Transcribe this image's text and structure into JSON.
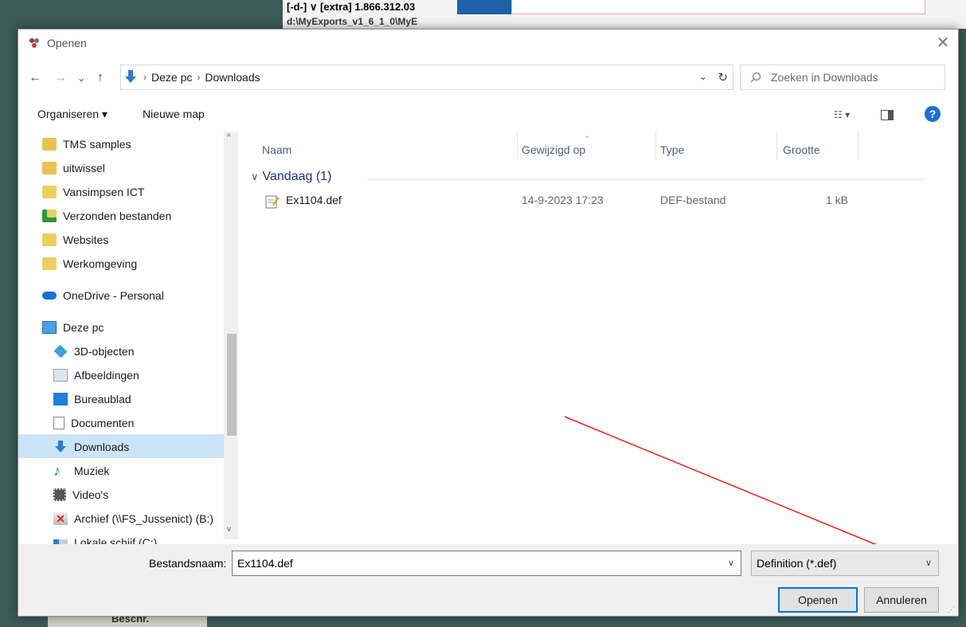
{
  "background": {
    "top_strip_text": "[-d-] ∨ [extra] 1.866.312.03",
    "top_strip_text2": "d:\\MyExports_v1_6_1_0\\MyE",
    "taskbar_label": "Beschr."
  },
  "dialog": {
    "title": "Openen",
    "close_glyph": "✕",
    "nav": {
      "back": "←",
      "forward": "→",
      "recent": "⌄",
      "up": "↑",
      "crumbs": [
        "Deze pc",
        "Downloads"
      ],
      "refresh": "↻",
      "search_placeholder": "Zoeken in Downloads"
    },
    "toolbar": {
      "organize": "Organiseren ▾",
      "new_folder": "Nieuwe map",
      "help": "?"
    },
    "sidebar": {
      "items": [
        {
          "label": "TMS samples",
          "icon": "shared-folder-icon"
        },
        {
          "label": "uitwissel",
          "icon": "shared-folder-icon"
        },
        {
          "label": "Vansimpsen ICT",
          "icon": "sync-folder-icon"
        },
        {
          "label": "Verzonden bestanden",
          "icon": "synced-folder-icon"
        },
        {
          "label": "Websites",
          "icon": "sync-folder-icon"
        },
        {
          "label": "Werkomgeving",
          "icon": "sync-folder-icon"
        },
        {
          "label": "OneDrive - Personal",
          "icon": "onedrive-icon"
        },
        {
          "label": "Deze pc",
          "icon": "pc-icon"
        },
        {
          "label": "3D-objecten",
          "icon": "3d-objects-icon"
        },
        {
          "label": "Afbeeldingen",
          "icon": "pictures-icon"
        },
        {
          "label": "Bureaublad",
          "icon": "desktop-icon"
        },
        {
          "label": "Documenten",
          "icon": "documents-icon"
        },
        {
          "label": "Downloads",
          "icon": "downloads-icon"
        },
        {
          "label": "Muziek",
          "icon": "music-icon"
        },
        {
          "label": "Video's",
          "icon": "videos-icon"
        },
        {
          "label": "Archief (\\\\FS_Jussenict) (B:)",
          "icon": "network-drive-icon"
        },
        {
          "label": "Lokale schijf (C:)",
          "icon": "local-disk-icon"
        }
      ],
      "selected": "Downloads"
    },
    "columns": [
      "Naam",
      "Gewijzigd op",
      "Type",
      "Grootte"
    ],
    "group": {
      "label": "Vandaag (1)",
      "chevron": "∨"
    },
    "files": [
      {
        "name": "Ex1104.def",
        "modified": "14-9-2023 17:23",
        "type": "DEF-bestand",
        "size": "1 kB"
      }
    ],
    "filename_label": "Bestandsnaam:",
    "filename_value": "Ex1104.def",
    "filter_value": "Definition (*.def)",
    "open_button": "Openen",
    "cancel_button": "Annuleren"
  },
  "colors": {
    "accent": "#0078d7",
    "selection": "#cce4f7",
    "group": "#1e3287",
    "arrow": "#e8261c"
  }
}
